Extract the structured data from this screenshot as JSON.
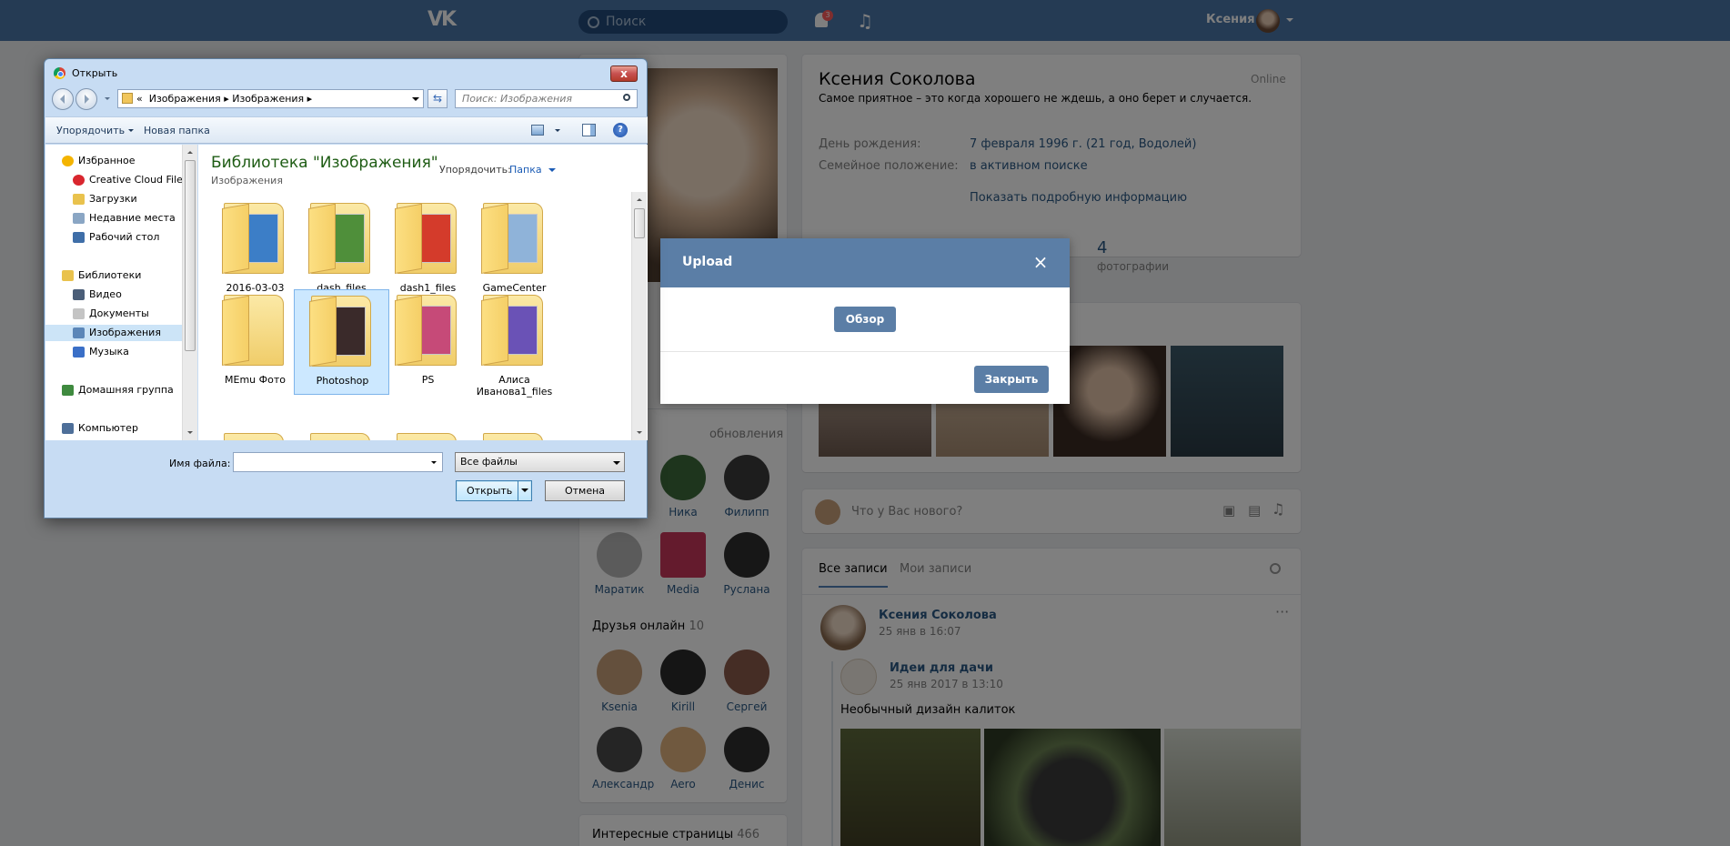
{
  "vk": {
    "logo": "VK",
    "search_placeholder": "Поиск",
    "notifications_count": "3",
    "user_name": "Ксения",
    "profile": {
      "name": "Ксения Соколова",
      "online": "Online",
      "status": "Самое приятное – это когда хорошего не ждешь, а оно берет и случается.",
      "birthday_label": "День рождения:",
      "birthday_value": "7 февраля 1996 г. (21 год, Водолей)",
      "family_label": "Семейное положение:",
      "family_value": "в активном поиске",
      "more_info": "Показать подробную информацию",
      "photos_count": "4",
      "photos_label": "фотографии"
    },
    "friends_updates": "обновления",
    "friends": [
      {
        "name": "Ника",
        "color": "#3d6b3a"
      },
      {
        "name": "Филипп",
        "color": "#3b3b3b"
      },
      {
        "name": "Маратик",
        "color": "#b7b7b7"
      },
      {
        "name": "Media",
        "color": "#c9375a"
      },
      {
        "name": "Руслана",
        "color": "#2f2f2f"
      }
    ],
    "friends_online_label": "Друзья онлайн",
    "friends_online_count": "10",
    "friends_online": [
      {
        "name": "Ksenia",
        "color": "#c9a07b"
      },
      {
        "name": "Kirill",
        "color": "#2a2a2a"
      },
      {
        "name": "Сергей",
        "color": "#8b5a4a"
      },
      {
        "name": "Александр",
        "color": "#4a4a4a"
      },
      {
        "name": "Aero",
        "color": "#e0b27f"
      },
      {
        "name": "Денис",
        "color": "#2e2e2e"
      }
    ],
    "interesting_label": "Интересные страницы",
    "interesting_count": "466",
    "whats_new": "Что у Вас нового?",
    "wall_tabs": [
      "Все записи",
      "Мои записи"
    ],
    "post": {
      "author": "Ксения Соколова",
      "date": "25 янв в 16:07",
      "repost_author": "Идеи для дачи",
      "repost_date": "25 янв 2017 в 13:10",
      "text": "Необычный дизайн калиток"
    }
  },
  "upload": {
    "title": "Upload",
    "close_icon": "×",
    "browse": "Обзор",
    "close": "Закрыть"
  },
  "dialog": {
    "title": "Открыть",
    "close_glyph": "x",
    "address": {
      "prefix": "«",
      "path": [
        "Изображения",
        "Изображения"
      ]
    },
    "search_placeholder": "Поиск: Изображения",
    "toolbar": {
      "organize": "Упорядочить",
      "new_folder": "Новая папка",
      "help": "?"
    },
    "nav": [
      {
        "label": "Избранное",
        "indent": 1,
        "icon": "star-icon",
        "color": "#f4b400"
      },
      {
        "label": "Creative Cloud Files",
        "indent": 2,
        "icon": "creative-cloud-icon",
        "color": "#d9262e"
      },
      {
        "label": "Загрузки",
        "indent": 2,
        "icon": "downloads-folder-icon",
        "color": "#e9c24d"
      },
      {
        "label": "Недавние места",
        "indent": 2,
        "icon": "recent-places-icon",
        "color": "#8aa6c4"
      },
      {
        "label": "Рабочий стол",
        "indent": 2,
        "icon": "desktop-icon",
        "color": "#3f6ea8"
      },
      {
        "label": "",
        "indent": 0,
        "icon": "",
        "color": ""
      },
      {
        "label": "Библиотеки",
        "indent": 1,
        "icon": "libraries-icon",
        "color": "#e9c24d"
      },
      {
        "label": "Видео",
        "indent": 2,
        "icon": "video-library-icon",
        "color": "#4b5e78"
      },
      {
        "label": "Документы",
        "indent": 2,
        "icon": "documents-library-icon",
        "color": "#c4c4c4"
      },
      {
        "label": "Изображения",
        "indent": 2,
        "icon": "images-library-icon",
        "color": "#5b86b8",
        "selected": true
      },
      {
        "label": "Музыка",
        "indent": 2,
        "icon": "music-library-icon",
        "color": "#3a6fc7"
      },
      {
        "label": "",
        "indent": 0,
        "icon": "",
        "color": ""
      },
      {
        "label": "Домашняя группа",
        "indent": 1,
        "icon": "homegroup-icon",
        "color": "#3f8a3f"
      },
      {
        "label": "",
        "indent": 0,
        "icon": "",
        "color": ""
      },
      {
        "label": "Компьютер",
        "indent": 1,
        "icon": "computer-icon",
        "color": "#4e6f99"
      }
    ],
    "library_title": "Библиотека \"Изображения\"",
    "library_subtitle": "Изображения",
    "arrange_label": "Упорядочить:",
    "arrange_value": "Папка",
    "folders": [
      {
        "name": "2016-03-03",
        "doc": "#3c7ec7"
      },
      {
        "name": "dash_files",
        "doc": "#4f8f3a"
      },
      {
        "name": "dash1_files",
        "doc": "#d43b2b"
      },
      {
        "name": "GameCenter",
        "doc": "#8fb3d9"
      },
      {
        "name": "MEmu Фото",
        "doc": ""
      },
      {
        "name": "Photoshop",
        "doc": "#3a2a2a",
        "selected": true
      },
      {
        "name": "PS",
        "doc": "#c64a78"
      },
      {
        "name": "Алиса Иванова1_files",
        "doc": "#6a52b6"
      }
    ],
    "filename_label": "Имя файла:",
    "filename_value": "",
    "filetype": "Все файлы",
    "open": "Открыть",
    "cancel": "Отмена"
  }
}
